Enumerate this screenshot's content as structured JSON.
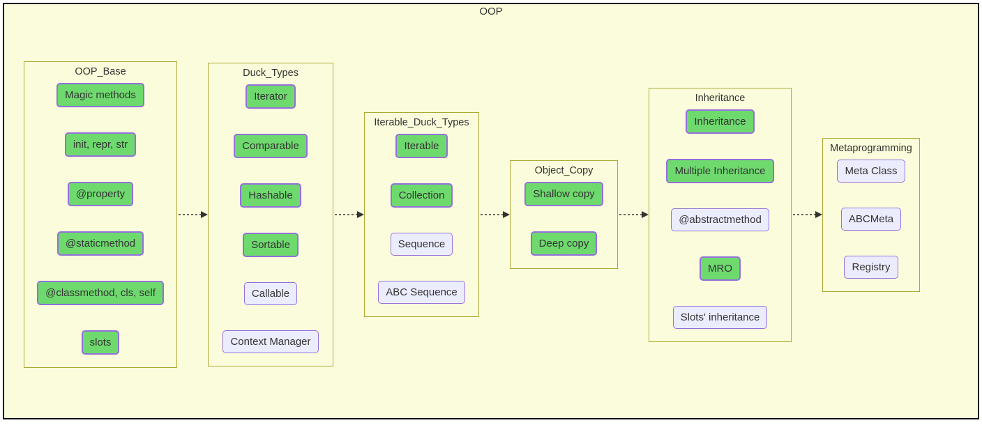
{
  "outer_title": "OOP",
  "groups": {
    "oop_base": {
      "title": "OOP_Base",
      "items": [
        "Magic methods",
        "init, repr, str",
        "@property",
        "@staticmethod",
        "@classmethod, cls, self",
        "slots"
      ]
    },
    "duck_types": {
      "title": "Duck_Types",
      "items": [
        "Iterator",
        "Comparable",
        "Hashable",
        "Sortable",
        "Callable",
        "Context Manager"
      ]
    },
    "iterable_duck_types": {
      "title": "Iterable_Duck_Types",
      "items": [
        "Iterable",
        "Collection",
        "Sequence",
        "ABC Sequence"
      ]
    },
    "object_copy": {
      "title": "Object_Copy",
      "items": [
        "Shallow copy",
        "Deep copy"
      ]
    },
    "inheritance": {
      "title": "Inheritance",
      "items": [
        "Inheritance",
        "Multiple Inheritance",
        "@abstractmethod",
        "MRO",
        "Slots' inheritance"
      ]
    },
    "metaprogramming": {
      "title": "Metaprogramming",
      "items": [
        "Meta Class",
        "ABCMeta",
        "Registry"
      ]
    }
  }
}
